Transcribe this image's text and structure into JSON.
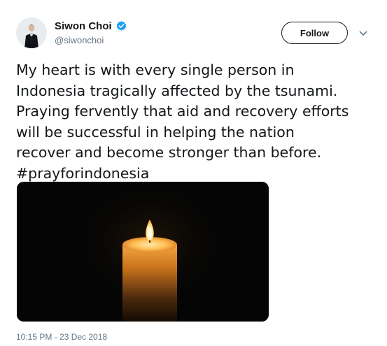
{
  "author": {
    "display_name": "Siwon Choi",
    "handle": "@siwonchoi",
    "verified": true
  },
  "actions": {
    "follow_label": "Follow",
    "more_icon": "chevron-down-icon"
  },
  "tweet": {
    "text_lines": [
      "My heart is with every single person in",
      "Indonesia tragically affected by the tsunami.",
      "Praying fervently that aid and recovery efforts",
      "will be successful in helping the nation",
      "recover and become stronger than before.",
      "#prayforindonesia"
    ],
    "media_icon": "candle-image",
    "timestamp": "10:15 PM - 23 Dec 2018"
  },
  "colors": {
    "text_primary": "#14171a",
    "text_secondary": "#657786",
    "verified_blue": "#1da1f2",
    "media_background": "#050505"
  }
}
